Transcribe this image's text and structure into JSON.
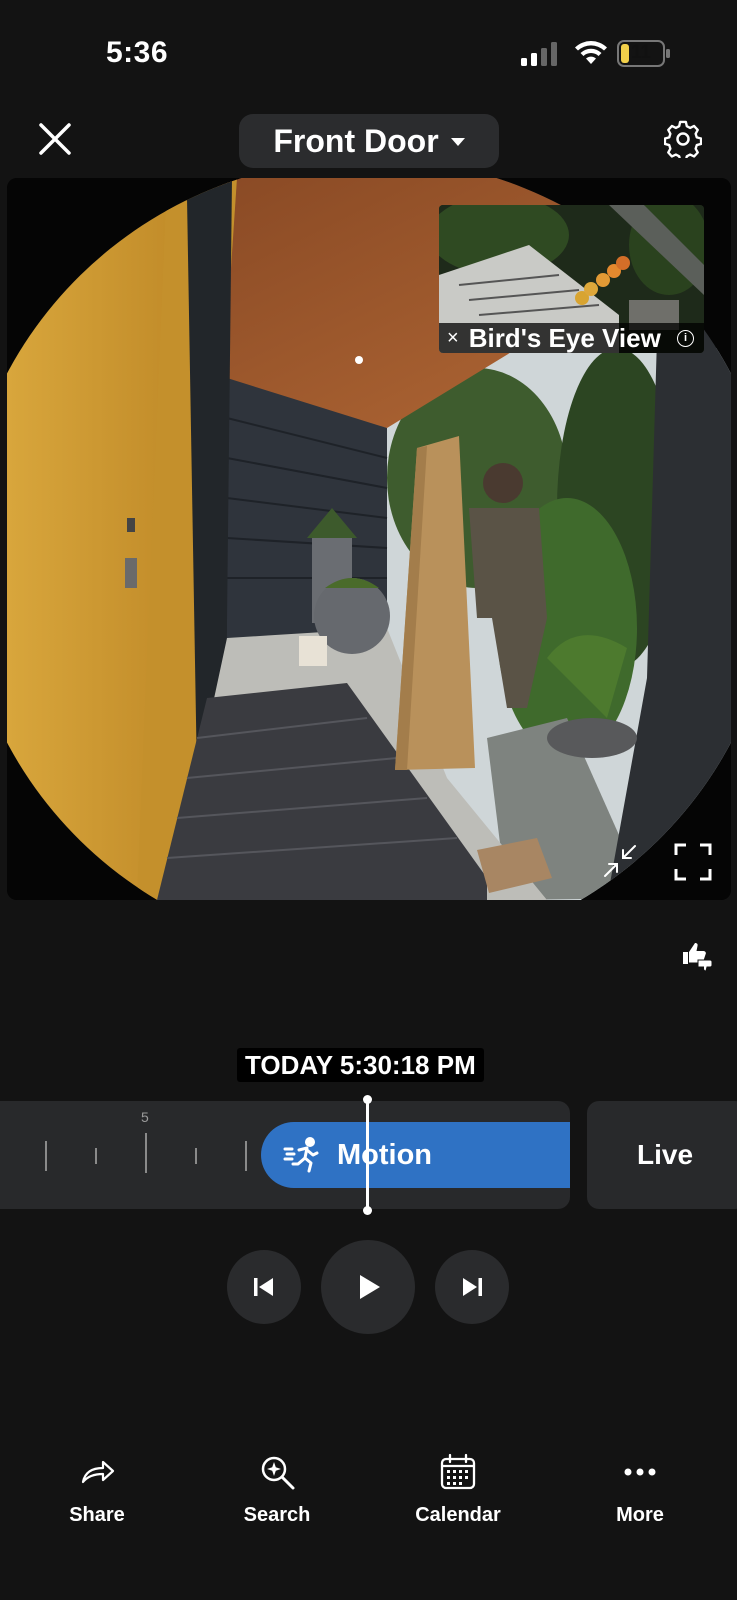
{
  "status_bar": {
    "time": "5:36",
    "battery_level": "11"
  },
  "header": {
    "camera_name": "Front Door"
  },
  "video": {
    "birds_eye": {
      "close_glyph": "×",
      "label": "Bird's Eye View",
      "info_glyph": "i"
    }
  },
  "timeline": {
    "timestamp": "TODAY 5:30:18 PM",
    "tick_label": "5",
    "event_label": "Motion",
    "live_label": "Live"
  },
  "nav": {
    "share": "Share",
    "search": "Search",
    "calendar": "Calendar",
    "more": "More"
  },
  "colors": {
    "accent": "#2f72c4",
    "battery": "#f2d04a",
    "background": "#131313"
  }
}
